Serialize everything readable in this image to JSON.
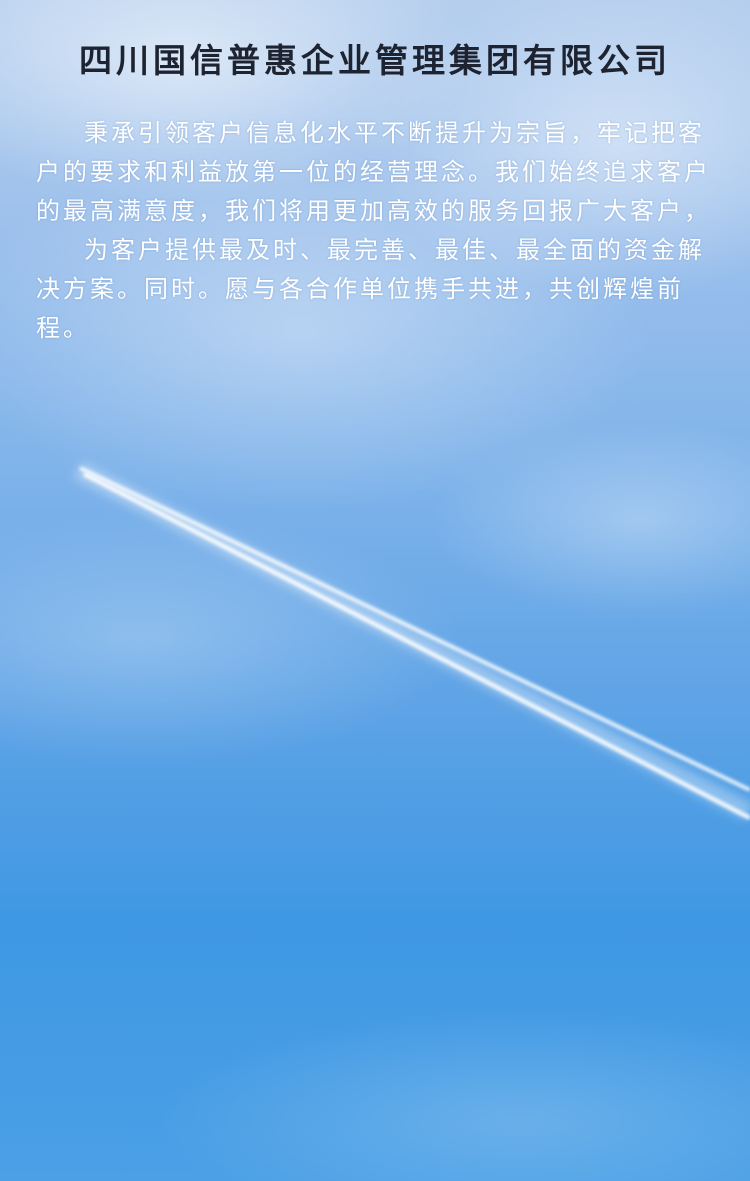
{
  "header": {
    "company_name": "四川国信普惠企业管理集团有限公司"
  },
  "body": {
    "paragraph_1": "秉承引领客户信息化水平不断提升为宗旨，牢记把客户的要求和利益放第一位的经营理念。我们始终追求客户的最高满意度，我们将用更加高效的服务回报广大客户，",
    "paragraph_2": "为客户提供最及时、最完善、最佳、最全面的资金解决方案。同时。愿与各合作单位携手共进，共创辉煌前程。"
  },
  "background": {
    "sky_top_color": "#b6cfee",
    "sky_bottom_color": "#3f98e3",
    "contrail_color": "#ffffff"
  }
}
